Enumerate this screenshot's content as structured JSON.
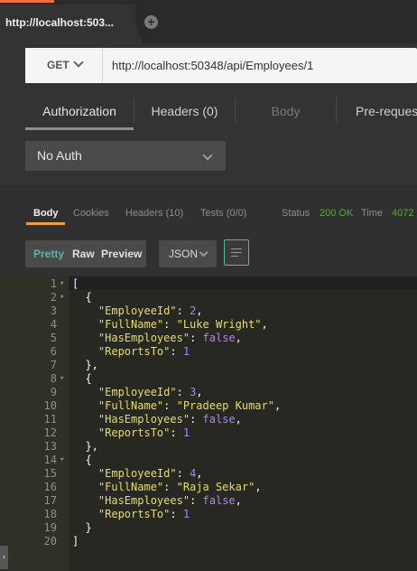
{
  "tab": {
    "title": "http://localhost:503...",
    "add_icon": "plus-icon"
  },
  "request": {
    "method": "GET",
    "url": "http://localhost:50348/api/Employees/1"
  },
  "request_tabs": [
    {
      "label": "Authorization"
    },
    {
      "label": "Headers (0)"
    },
    {
      "label": "Body"
    },
    {
      "label": "Pre-request"
    }
  ],
  "auth": {
    "selected": "No Auth"
  },
  "response_tabs": [
    {
      "label": "Body"
    },
    {
      "label": "Cookies"
    },
    {
      "label": "Headers (10)"
    },
    {
      "label": "Tests (0/0)"
    }
  ],
  "status": {
    "status_label": "Status",
    "status_value": "200 OK",
    "time_label": "Time",
    "time_value": "4072"
  },
  "format": {
    "pretty": "Pretty",
    "raw": "Raw",
    "preview": "Preview",
    "language": "JSON"
  },
  "code_lines": [
    {
      "n": "1",
      "fold": true,
      "tokens": [
        [
          "p",
          "["
        ]
      ]
    },
    {
      "n": "2",
      "fold": true,
      "tokens": [
        [
          "p",
          "  {"
        ]
      ]
    },
    {
      "n": "3",
      "fold": false,
      "tokens": [
        [
          "p",
          "    "
        ],
        [
          "k",
          "\"EmployeeId\""
        ],
        [
          "p",
          ": "
        ],
        [
          "n",
          "2"
        ],
        [
          "p",
          ","
        ]
      ]
    },
    {
      "n": "4",
      "fold": false,
      "tokens": [
        [
          "p",
          "    "
        ],
        [
          "k",
          "\"FullName\""
        ],
        [
          "p",
          ": "
        ],
        [
          "s",
          "\"Luke Wright\""
        ],
        [
          "p",
          ","
        ]
      ]
    },
    {
      "n": "5",
      "fold": false,
      "tokens": [
        [
          "p",
          "    "
        ],
        [
          "k",
          "\"HasEmployees\""
        ],
        [
          "p",
          ": "
        ],
        [
          "b",
          "false"
        ],
        [
          "p",
          ","
        ]
      ]
    },
    {
      "n": "6",
      "fold": false,
      "tokens": [
        [
          "p",
          "    "
        ],
        [
          "k",
          "\"ReportsTo\""
        ],
        [
          "p",
          ": "
        ],
        [
          "n",
          "1"
        ]
      ]
    },
    {
      "n": "7",
      "fold": false,
      "tokens": [
        [
          "p",
          "  },"
        ]
      ]
    },
    {
      "n": "8",
      "fold": true,
      "tokens": [
        [
          "p",
          "  {"
        ]
      ]
    },
    {
      "n": "9",
      "fold": false,
      "tokens": [
        [
          "p",
          "    "
        ],
        [
          "k",
          "\"EmployeeId\""
        ],
        [
          "p",
          ": "
        ],
        [
          "n",
          "3"
        ],
        [
          "p",
          ","
        ]
      ]
    },
    {
      "n": "10",
      "fold": false,
      "tokens": [
        [
          "p",
          "    "
        ],
        [
          "k",
          "\"FullName\""
        ],
        [
          "p",
          ": "
        ],
        [
          "s",
          "\"Pradeep Kumar\""
        ],
        [
          "p",
          ","
        ]
      ]
    },
    {
      "n": "11",
      "fold": false,
      "tokens": [
        [
          "p",
          "    "
        ],
        [
          "k",
          "\"HasEmployees\""
        ],
        [
          "p",
          ": "
        ],
        [
          "b",
          "false"
        ],
        [
          "p",
          ","
        ]
      ]
    },
    {
      "n": "12",
      "fold": false,
      "tokens": [
        [
          "p",
          "    "
        ],
        [
          "k",
          "\"ReportsTo\""
        ],
        [
          "p",
          ": "
        ],
        [
          "n",
          "1"
        ]
      ]
    },
    {
      "n": "13",
      "fold": false,
      "tokens": [
        [
          "p",
          "  },"
        ]
      ]
    },
    {
      "n": "14",
      "fold": true,
      "tokens": [
        [
          "p",
          "  {"
        ]
      ]
    },
    {
      "n": "15",
      "fold": false,
      "tokens": [
        [
          "p",
          "    "
        ],
        [
          "k",
          "\"EmployeeId\""
        ],
        [
          "p",
          ": "
        ],
        [
          "n",
          "4"
        ],
        [
          "p",
          ","
        ]
      ]
    },
    {
      "n": "16",
      "fold": false,
      "tokens": [
        [
          "p",
          "    "
        ],
        [
          "k",
          "\"FullName\""
        ],
        [
          "p",
          ": "
        ],
        [
          "s",
          "\"Raja Sekar\""
        ],
        [
          "p",
          ","
        ]
      ]
    },
    {
      "n": "17",
      "fold": false,
      "tokens": [
        [
          "p",
          "    "
        ],
        [
          "k",
          "\"HasEmployees\""
        ],
        [
          "p",
          ": "
        ],
        [
          "b",
          "false"
        ],
        [
          "p",
          ","
        ]
      ]
    },
    {
      "n": "18",
      "fold": false,
      "tokens": [
        [
          "p",
          "    "
        ],
        [
          "k",
          "\"ReportsTo\""
        ],
        [
          "p",
          ": "
        ],
        [
          "n",
          "1"
        ]
      ]
    },
    {
      "n": "19",
      "fold": false,
      "tokens": [
        [
          "p",
          "  }"
        ]
      ]
    },
    {
      "n": "20",
      "fold": false,
      "tokens": [
        [
          "p",
          "]"
        ]
      ]
    }
  ],
  "side_handle_icon": "chevron-left-icon",
  "colors": {
    "accent": "#f26b3a",
    "status_ok": "#5aa836",
    "pretty_active": "#5ab4a8",
    "body_tab_underline": "#f0a030"
  }
}
